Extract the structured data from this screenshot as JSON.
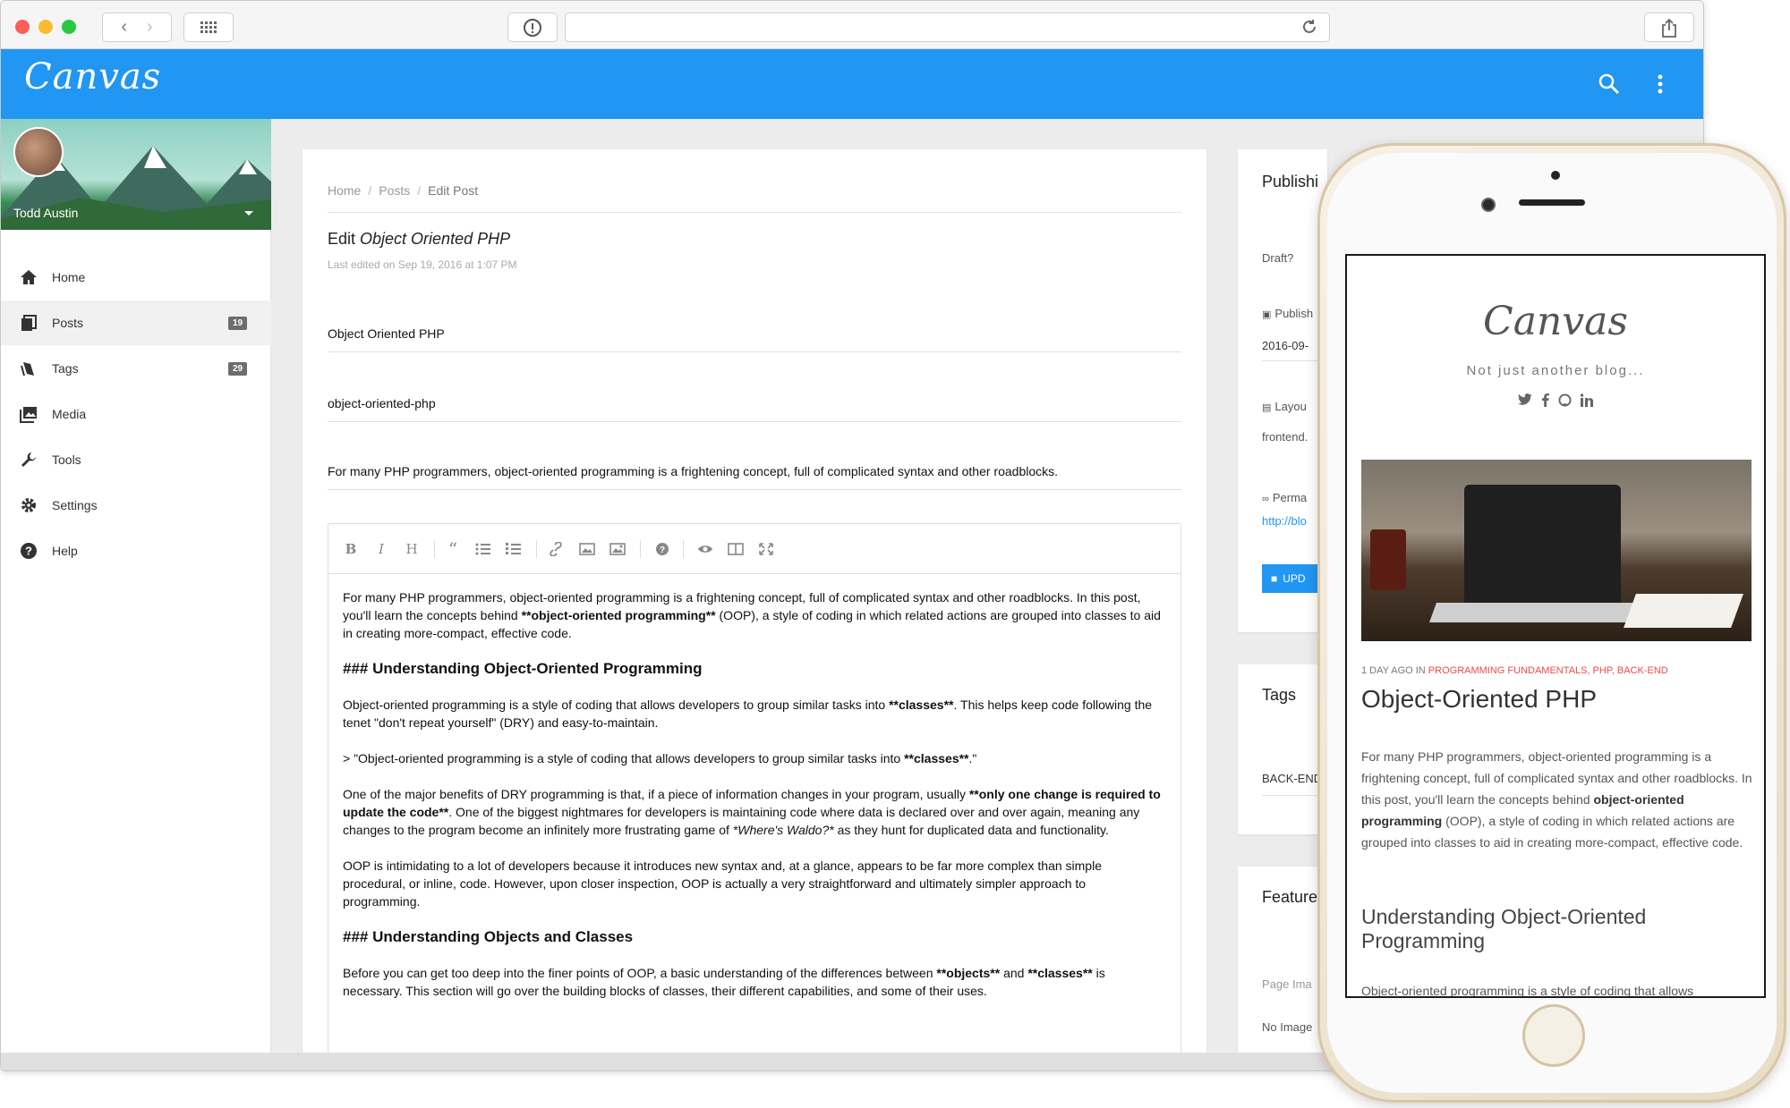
{
  "app": {
    "logo": "Canvas",
    "user": "Todd Austin"
  },
  "sidebar": {
    "items": [
      {
        "label": "Home",
        "icon": "home-icon"
      },
      {
        "label": "Posts",
        "icon": "posts-icon",
        "badge": "19"
      },
      {
        "label": "Tags",
        "icon": "tags-icon",
        "badge": "29"
      },
      {
        "label": "Media",
        "icon": "media-icon"
      },
      {
        "label": "Tools",
        "icon": "wrench-icon"
      },
      {
        "label": "Settings",
        "icon": "gear-icon"
      },
      {
        "label": "Help",
        "icon": "help-icon"
      }
    ]
  },
  "breadcrumb": [
    "Home",
    "Posts",
    "Edit Post"
  ],
  "editor": {
    "title_prefix": "Edit ",
    "title_post": "Object Oriented PHP",
    "last_edited": "Last edited on Sep 19, 2016 at 1:07 PM",
    "fields": {
      "title": "Object Oriented PHP",
      "slug": "object-oriented-php",
      "subtitle": "For many PHP programmers, object-oriented programming is a frightening concept, full of complicated syntax and other roadblocks."
    },
    "markdown": {
      "p1a": "For many PHP programmers, object-oriented programming is a frightening concept, full of complicated syntax and other roadblocks. In this post, you'll learn the concepts behind ",
      "p1b": "**object-oriented programming**",
      "p1c": " (OOP), a style of coding in which related actions are grouped into classes to aid in creating more-compact, effective code.",
      "h1": "### Understanding Object-Oriented Programming",
      "p2a": "Object-oriented programming is a style of coding that allows developers to group similar tasks into ",
      "p2b": "**classes**",
      "p2c": ". This helps keep code following the tenet \"don't repeat yourself\" (DRY) and easy-to-maintain.",
      "q1a": "> \"Object-oriented programming is a style of coding that allows developers to group similar tasks into ",
      "q1b": "**classes**",
      "q1c": ".\"",
      "p3a": "One of the major benefits of DRY programming is that, if a piece of information changes in your program, usually ",
      "p3b": "**only one change is required to update the code**",
      "p3c": ". One of the biggest nightmares for developers is maintaining code where data is declared over and over again, meaning any changes to the program become an infinitely more frustrating game of ",
      "p3d": "*Where's Waldo?*",
      "p3e": " as they hunt for duplicated data and functionality.",
      "p4": "OOP is intimidating to a lot of developers because it introduces new syntax and, at a glance, appears to be far more complex than simple procedural, or inline, code. However, upon closer inspection, OOP is actually a very straightforward and ultimately simpler approach to programming.",
      "h2": "### Understanding Objects and Classes",
      "p5a": "Before you can get too deep into the finer points of OOP, a basic understanding of the differences between ",
      "p5b": "**objects**",
      "p5c": " and ",
      "p5d": "**classes**",
      "p5e": " is necessary. This section will go over the building blocks of classes, their different capabilities, and some of their uses."
    }
  },
  "publishing": {
    "title": "Publishi",
    "draft_label": "Draft?",
    "publish_label": "Publish",
    "publish_value": "2016-09-",
    "layout_label": "Layou",
    "layout_value": "frontend.",
    "permalink_label": "Perma",
    "permalink_value": "http://blo",
    "update_button": "UPD"
  },
  "tags_card": {
    "title": "Tags",
    "value": "BACK-END"
  },
  "feature_card": {
    "title": "Feature",
    "page_image_label": "Page Ima",
    "no_image": "No Image"
  },
  "phone": {
    "blog_logo": "Canvas",
    "tagline": "Not just another blog...",
    "social": [
      "twitter-icon",
      "facebook-icon",
      "github-icon",
      "linkedin-icon"
    ],
    "meta_prefix": "1 DAY AGO IN ",
    "meta_categories": "PROGRAMMING FUNDAMENTALS, PHP, BACK-END",
    "post_title": "Object-Oriented PHP",
    "body_a": "For many PHP programmers, object-oriented programming is a frightening concept, full of complicated syntax and other roadblocks. In this post, you'll learn the concepts behind ",
    "body_b": "object-oriented programming",
    "body_c": " (OOP), a style of coding in which related actions are grouped into classes to aid in creating more-compact, effective code.",
    "heading": "Understanding Object-Oriented Programming",
    "body2": "Object-oriented programming is a style of coding that allows"
  },
  "colors": {
    "brand": "#2196f3",
    "category_link": "#e84b4b"
  }
}
